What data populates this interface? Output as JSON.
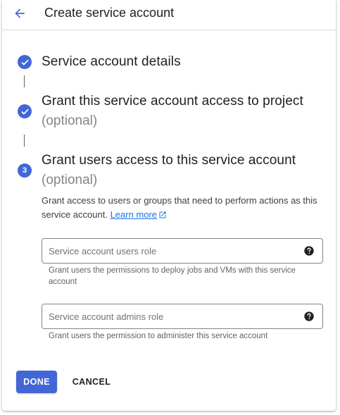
{
  "header": {
    "title": "Create service account",
    "back_icon": "arrow-back-icon"
  },
  "colors": {
    "accent": "#4366d6",
    "link": "#1a73e8",
    "text_primary": "#202124",
    "text_secondary": "#5f6368",
    "optional": "#80868b"
  },
  "steps": [
    {
      "status": "complete",
      "icon": "check-icon",
      "title": "Service account details"
    },
    {
      "status": "complete",
      "icon": "check-icon",
      "title": "Grant this service account access to project",
      "optional": "(optional)"
    },
    {
      "status": "active",
      "number": "3",
      "title": "Grant users access to this service account",
      "optional": "(optional)",
      "description": "Grant access to users or groups that need to perform actions as this service account.",
      "learn_more": "Learn more",
      "fields": [
        {
          "placeholder": "Service account users role",
          "value": "",
          "help_icon": "help-icon",
          "hint": "Grant users the permissions to deploy jobs and VMs with this service account"
        },
        {
          "placeholder": "Service account admins role",
          "value": "",
          "help_icon": "help-icon",
          "hint": "Grant users the permission to administer this service account"
        }
      ]
    }
  ],
  "actions": {
    "done_label": "DONE",
    "cancel_label": "CANCEL"
  }
}
